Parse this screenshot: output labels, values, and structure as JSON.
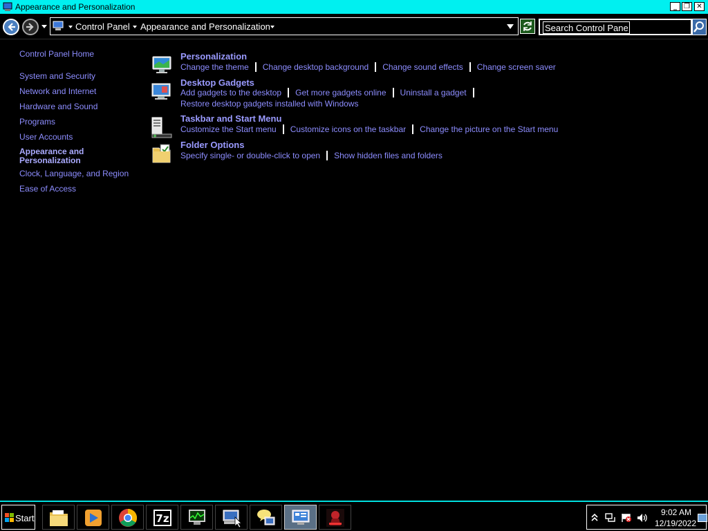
{
  "window": {
    "title": "Appearance and Personalization",
    "minimize_label": "_",
    "restore_label": "❐",
    "close_label": "✕"
  },
  "address": {
    "breadcrumbs": [
      "Control Panel",
      "Appearance and Personalization"
    ],
    "search_placeholder": "Search Control Panel"
  },
  "leftnav": {
    "items": [
      {
        "label": "Control Panel Home"
      },
      {
        "label": "System and Security"
      },
      {
        "label": "Network and Internet"
      },
      {
        "label": "Hardware and Sound"
      },
      {
        "label": "Programs"
      },
      {
        "label": "User Accounts"
      },
      {
        "label": "Appearance and Personalization",
        "current": true
      },
      {
        "label": "Clock, Language, and Region"
      },
      {
        "label": "Ease of Access"
      }
    ]
  },
  "categories": [
    {
      "title": "Personalization",
      "icon": "personalization-icon",
      "tasks": [
        "Change the theme",
        "Change desktop background",
        "Change sound effects",
        "Change screen saver"
      ]
    },
    {
      "title": "Desktop Gadgets",
      "icon": "desktop-gadgets-icon",
      "tasks": [
        "Add gadgets to the desktop",
        "Get more gadgets online",
        "Uninstall a gadget"
      ],
      "tasks2": [
        "Restore desktop gadgets installed with Windows"
      ]
    },
    {
      "title": "Taskbar and Start Menu",
      "icon": "taskbar-icon",
      "tasks": [
        "Customize the Start menu",
        "Customize icons on the taskbar",
        "Change the picture on the Start menu"
      ]
    },
    {
      "title": "Folder Options",
      "icon": "folder-options-icon",
      "tasks": [
        "Specify single- or double-click to open",
        "Show hidden files and folders"
      ]
    }
  ],
  "taskbar": {
    "start_label": "Start",
    "apps": [
      "explorer-icon",
      "media-player-icon",
      "chrome-icon",
      "7zip-icon",
      "task-manager-icon",
      "remote-desktop-icon",
      "messenger-icon",
      "control-panel-icon",
      "game-icon"
    ],
    "sevenzip_text": "7z",
    "clock_time": "9:02 AM",
    "clock_date": "12/19/2022"
  },
  "colors": {
    "titlebar": "#00f0f0",
    "link": "#8d8dff",
    "heading": "#9a9aff"
  }
}
